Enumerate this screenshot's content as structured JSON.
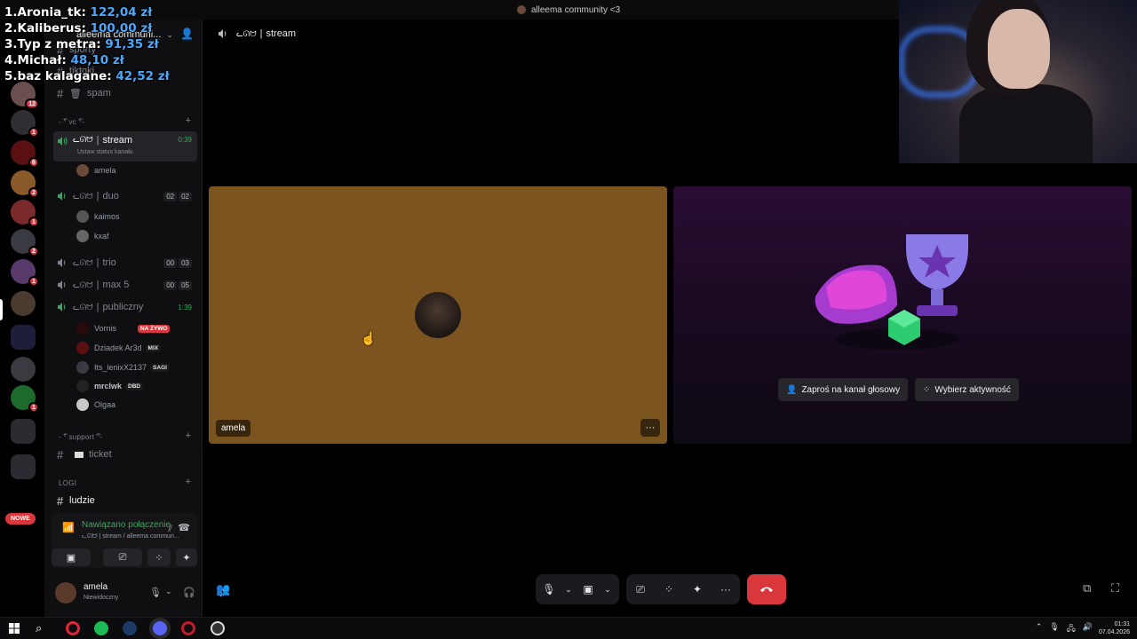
{
  "window": {
    "title": "alleema community <3"
  },
  "server": {
    "name": "alleema communi..."
  },
  "leaderboard": [
    {
      "rank": "1.",
      "name": "Aronia_tk:",
      "amount": "122,04 zł"
    },
    {
      "rank": "2.",
      "name": "Kaliberus:",
      "amount": "100,00 zł"
    },
    {
      "rank": "3.",
      "name": "Typ z metra:",
      "amount": "91,35 zł"
    },
    {
      "rank": "4.",
      "name": "Michał:",
      "amount": "48,10 zł"
    },
    {
      "rank": "5.",
      "name": "baz kalagane:",
      "amount": "42,52 zł"
    }
  ],
  "rail_badges": [
    "12",
    "1",
    "6",
    "2",
    "1",
    "2",
    "1",
    "1"
  ],
  "rail_nowe": "NOWE",
  "channels_top": [
    {
      "name": "sporty"
    },
    {
      "name": "tiktoki"
    },
    {
      "name": "spam"
    }
  ],
  "categories": {
    "vc": "- ͡° vc ͡°-",
    "support": "- ͡° support ͡°-",
    "logi": "LOGI"
  },
  "voice_channels": {
    "stream": {
      "name": "stream",
      "emoji": "ᓚᘏᗢ",
      "time": "0:39",
      "status": "Ustaw status kanału",
      "users": [
        "amela"
      ]
    },
    "duo": {
      "name": "duo",
      "emoji": "ᓚᘏᗢ",
      "count_a": "02",
      "count_b": "02",
      "users": [
        "kaimos",
        "kxaf"
      ]
    },
    "trio": {
      "name": "trio",
      "emoji": "ᓚᘏᗢ",
      "count_a": "00",
      "count_b": "03"
    },
    "max5": {
      "name": "max 5",
      "emoji": "ᓚᘏᗢ",
      "count_a": "00",
      "count_b": "05"
    },
    "publiczny": {
      "name": "publiczny",
      "emoji": "ᓚᘏᗢ",
      "time": "1:39",
      "users": [
        {
          "name": "Vornis",
          "tag": "NA ŻYWO"
        },
        {
          "name": "Dziadek Ar3d",
          "tag": "MIX"
        },
        {
          "name": "Its_lenixX2137",
          "tag": "SAGI"
        },
        {
          "name": "mrclwk",
          "tag": "DBD"
        },
        {
          "name": "Olgaa",
          "tag": ""
        }
      ]
    }
  },
  "text_channels": {
    "ticket": "ticket",
    "ludzie": "ludzie"
  },
  "voice_panel": {
    "status": "Nawiązano połączenie",
    "sub": "ᓚᘏᗢ | stream / alleema commun..."
  },
  "user_panel": {
    "name": "amela",
    "status": "Niewidoczny"
  },
  "main": {
    "channel_header": "stream",
    "channel_header_emoji": "ᓚᘏᗢ",
    "participant_name": "amela",
    "invite_button": "Zaproś na kanał głosowy",
    "activity_button": "Wybierz aktywność"
  },
  "taskbar": {
    "time": "01:31",
    "date": "07.04.2026"
  },
  "colors": {
    "accent_green": "#3ba55d",
    "danger_red": "#da373c",
    "tile_brown": "#7b5420",
    "leaderboard_amount": "#4aa8ff"
  }
}
